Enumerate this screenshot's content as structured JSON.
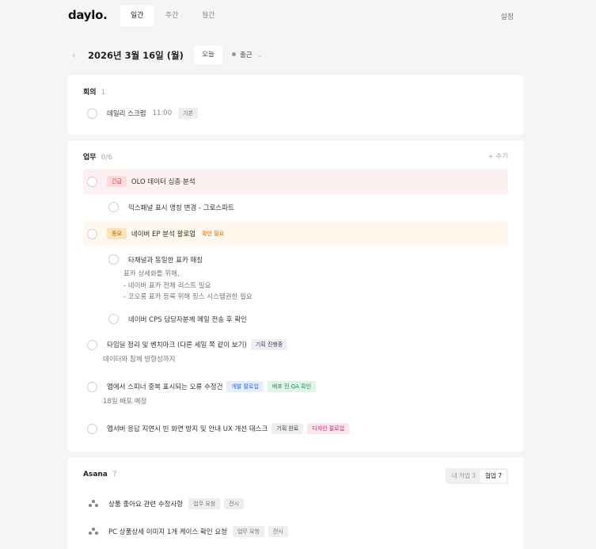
{
  "header": {
    "logo": "daylo.",
    "tabs": [
      {
        "label": "일간",
        "active": true
      },
      {
        "label": "주간",
        "active": false
      },
      {
        "label": "월간",
        "active": false
      }
    ],
    "settings_label": "설정"
  },
  "datebar": {
    "prev_icon": "chevron-left-icon",
    "date": "2026년 3월 16일 (월)",
    "next_icon": "chevron-right-icon",
    "today_label": "오늘",
    "status_label": "출근"
  },
  "meeting": {
    "title": "회의",
    "count": "1",
    "tasks": [
      {
        "text": "데일리 스크럼",
        "time": "11:00",
        "tag": "기본"
      }
    ]
  },
  "work": {
    "title": "업무",
    "count": "0/6",
    "add_label": "+ 추가",
    "tasks": [
      {
        "priority": "긴급",
        "text": "OLO 데이터 심층 분석",
        "sub": [
          {
            "text": "믹스패널 표시 명칭 변경 - 그로스파트"
          }
        ]
      },
      {
        "priority": "중요",
        "text": "네이버 EP 분석 팔로업",
        "flag": "확인 필요",
        "sub": [
          {
            "text": "타채널과 동일한 표카 매칭",
            "note": [
              "표카 상세화를 위해,",
              "- 네이버 표카 전체 리스트 필요",
              "- 코오롱 표카 등록 위해 핑스 시스템권한 필요"
            ]
          },
          {
            "text": "네이버 CPS 담당자분께 메일 전송 후 확인"
          }
        ]
      },
      {
        "text": "타임딜 정리 및 벤치마크 (다른 세일 쪽 같이 보기)",
        "tags": [
          "기획 진행중"
        ],
        "note": "데이터와 참께 방향성까지"
      },
      {
        "text": "앱에서 스피너 중복 표시되는 오류 수정건",
        "tags": [
          "개발 팔로업",
          "배포 전 QA 확인"
        ],
        "note": "18일 배포 예정"
      },
      {
        "text": "앱서버 응답 지연시 빈 화면 방지 및 안내 UX 개선 태스크",
        "tags": [
          "기획 완료",
          "디자인 팔로업"
        ]
      }
    ]
  },
  "asana": {
    "title": "Asana",
    "count": "7",
    "toggle": [
      {
        "label": "내 작업 3",
        "active": false
      },
      {
        "label": "협업 7",
        "active": true
      }
    ],
    "tasks": [
      {
        "text": "상품 좋아요 관련 수정사항",
        "tags": [
          "업무 요청",
          "전시"
        ]
      },
      {
        "text": "PC 상품상세 이미지 1개 케이스 확인 요청",
        "tags": [
          "업무 요청",
          "전시"
        ]
      }
    ]
  },
  "colors": {
    "background": "#f5f5f5",
    "card": "#ffffff",
    "urgent": "#d23b3b",
    "important": "#b2620b"
  }
}
